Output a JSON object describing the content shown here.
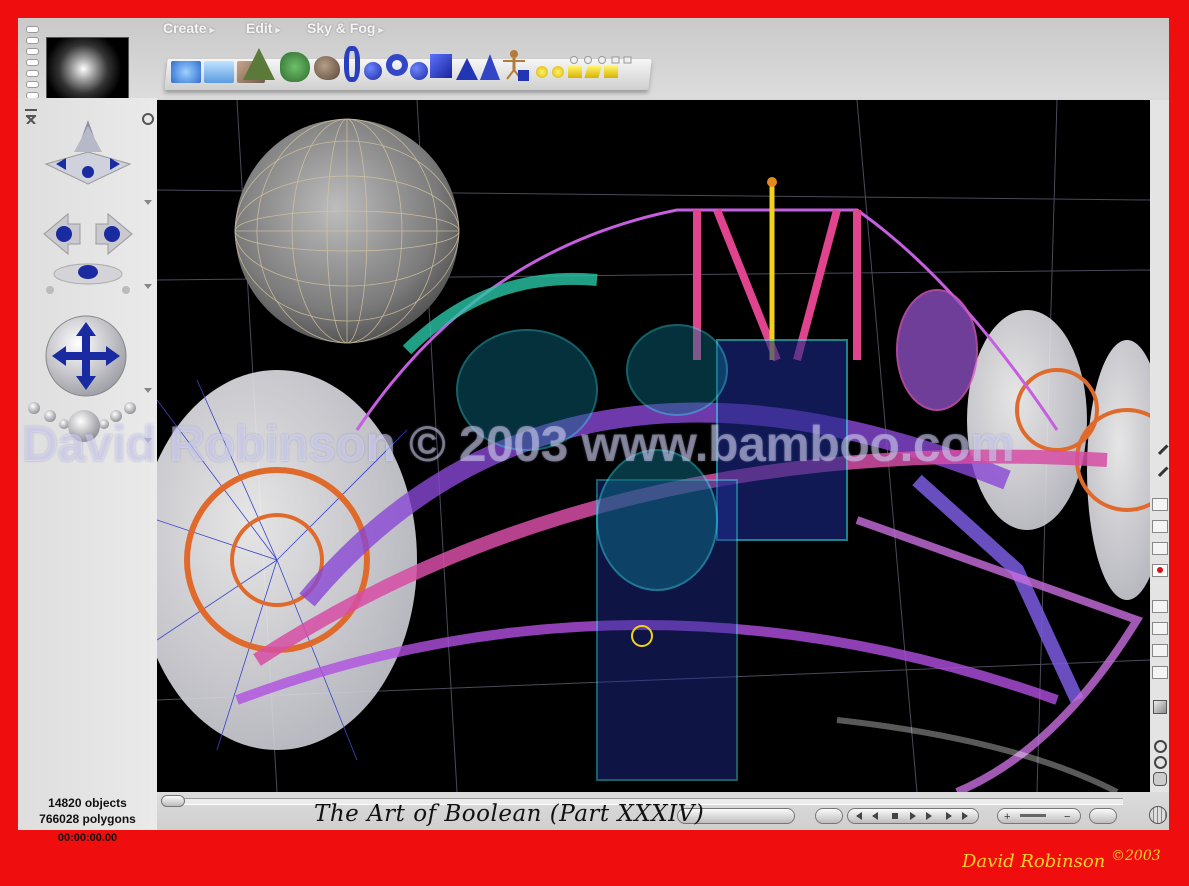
{
  "menu": {
    "create": "Create",
    "edit": "Edit",
    "sky_fog": "Sky & Fog"
  },
  "status": {
    "objects": "14820 objects",
    "polygons": "766028 polygons",
    "time": "00:00:00.00"
  },
  "caption": "The Art of Boolean (Part XXXIV)",
  "watermark": "David Robinson © 2003 www.bamboo.com",
  "signature": {
    "name": "David Robinson",
    "year": "©2003"
  },
  "shelf_items": [
    "water-icon",
    "sky-icon",
    "terrain-texture-icon",
    "mountain-icon",
    "tree-icon",
    "rock-icon",
    "spiral-icon",
    "sphere-icon",
    "torus-icon",
    "cube-icon",
    "pyramid-icon",
    "cone-icon",
    "cylinder-icon",
    "figure-icon",
    "box-icon",
    "lights-icon"
  ],
  "colors": {
    "frame": "#f00d0d",
    "app_bg": "#d9d9d9",
    "accent_blue": "#1d2fa6",
    "signature": "#ffd22a"
  }
}
